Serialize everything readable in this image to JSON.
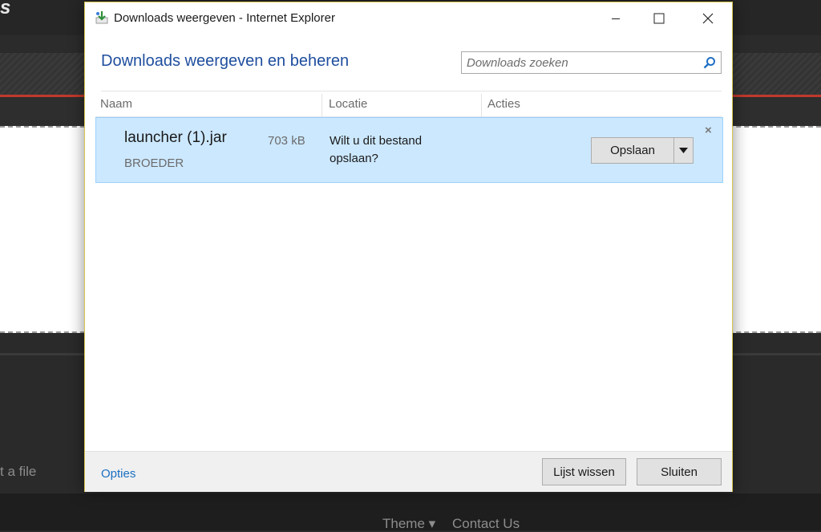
{
  "background": {
    "logo_fragment": "s",
    "file_fragment": "t a file",
    "footer_theme": "Theme ▾",
    "footer_contact": "Contact Us"
  },
  "window": {
    "title": "Downloads weergeven - Internet Explorer",
    "minimize_icon": "minimize-icon",
    "maximize_icon": "maximize-icon",
    "close_icon": "close-icon"
  },
  "header": {
    "heading": "Downloads weergeven en beheren",
    "search_placeholder": "Downloads zoeken"
  },
  "columns": [
    "Naam",
    "Locatie",
    "Acties"
  ],
  "downloads": [
    {
      "name": "launcher (1).jar",
      "size": "703 kB",
      "source": "BROEDER",
      "question": "Wilt u dit bestand opslaan?",
      "action_label": "Opslaan",
      "remove_symbol": "×"
    }
  ],
  "footer": {
    "options_label": "Opties",
    "clear_label": "Lijst wissen",
    "close_label": "Sluiten"
  },
  "colors": {
    "accent": "#1f4e9e",
    "row_highlight": "#cce8ff",
    "link": "#1a6fc2"
  }
}
